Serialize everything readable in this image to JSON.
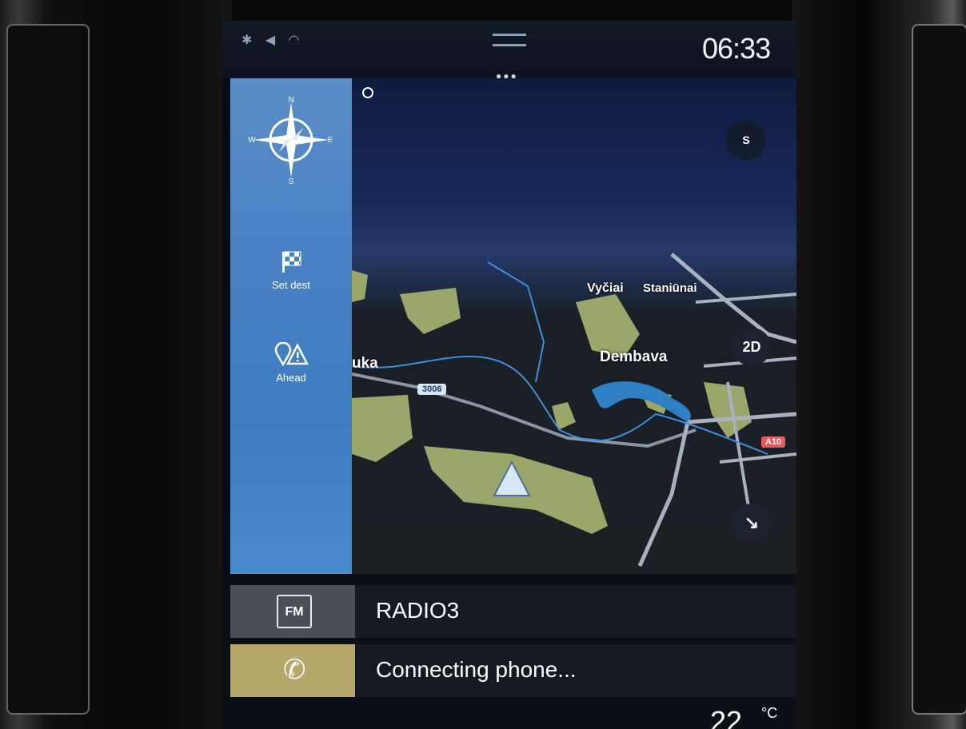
{
  "status": {
    "icons": [
      "bluetooth-icon",
      "location-icon",
      "wifi-icon"
    ],
    "time": "06:33"
  },
  "nav": {
    "compass_letters": {
      "n": "N",
      "s": "S",
      "e": "E",
      "w": "W"
    },
    "set_dest": "Set dest",
    "ahead": "Ahead",
    "view_mode": "2D",
    "compass_mini": "S"
  },
  "map": {
    "places": [
      "Vyčiai",
      "Staniūnai",
      "Dembava",
      "uka"
    ],
    "road_shields": [
      "3006",
      "A10"
    ]
  },
  "media": {
    "source_badge": "FM",
    "station": "RADIO3"
  },
  "phone": {
    "status": "Connecting phone..."
  },
  "climate": {
    "temp": "22",
    "unit": "°C"
  },
  "colors": {
    "sidebar": "#4a82c4",
    "phone_accent": "#b5a86a",
    "fm_bg": "#4a4e55"
  }
}
